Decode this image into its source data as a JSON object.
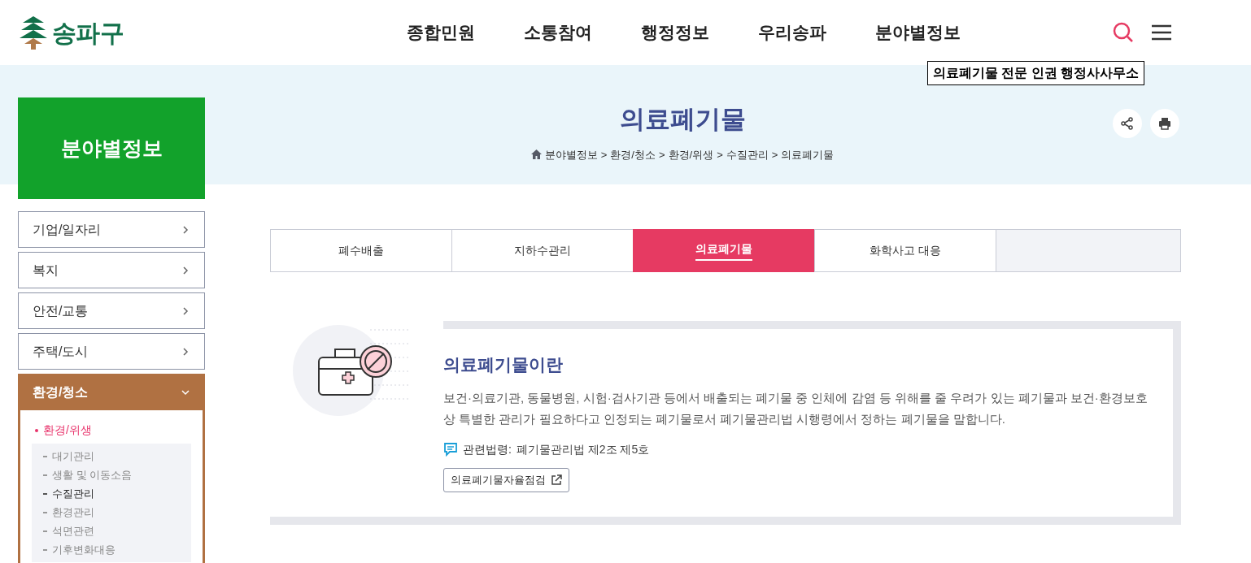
{
  "header": {
    "logo_text": "송파구",
    "nav": [
      "종합민원",
      "소통참여",
      "행정정보",
      "우리송파",
      "분야별정보"
    ]
  },
  "tooltip": "의료폐기물 전문 인권 행정사사무소",
  "page": {
    "title": "의료폐기물",
    "breadcrumb": [
      "분야별정보",
      "환경/청소",
      "환경/위생",
      "수질관리",
      "의료폐기물"
    ],
    "separator": ">"
  },
  "sidebar": {
    "title": "분야별정보",
    "items": [
      {
        "label": "기업/일자리",
        "expanded": false
      },
      {
        "label": "복지",
        "expanded": false
      },
      {
        "label": "안전/교통",
        "expanded": false
      },
      {
        "label": "주택/도시",
        "expanded": false
      },
      {
        "label": "환경/청소",
        "expanded": true,
        "children": [
          {
            "label": "환경/위생",
            "selected": true,
            "children": [
              {
                "label": "대기관리",
                "selected": false
              },
              {
                "label": "생활 및 이동소음",
                "selected": false
              },
              {
                "label": "수질관리",
                "selected": true
              },
              {
                "label": "환경관리",
                "selected": false
              },
              {
                "label": "석면관련",
                "selected": false
              },
              {
                "label": "기후변화대응",
                "selected": false
              }
            ]
          }
        ]
      }
    ]
  },
  "tabs": [
    {
      "label": "폐수배출",
      "selected": false
    },
    {
      "label": "지하수관리",
      "selected": false
    },
    {
      "label": "의료폐기물",
      "selected": true
    },
    {
      "label": "화학사고 대응",
      "selected": false
    }
  ],
  "section": {
    "heading": "의료폐기물이란",
    "body": "보건·의료기관, 동물병원, 시험·검사기관 등에서 배출되는 폐기물 중 인체에 감염 등 위해를 줄 우려가 있는 폐기물과 보건·환경보호 상 특별한 관리가 필요하다고 인정되는 폐기물로서 폐기물관리법 시행령에서 정하는 폐기물을 말합니다.",
    "law_label": "관련법령:",
    "law_text": "폐기물관리법 제2조 제5호",
    "link": "의료폐기물자율점검"
  }
}
